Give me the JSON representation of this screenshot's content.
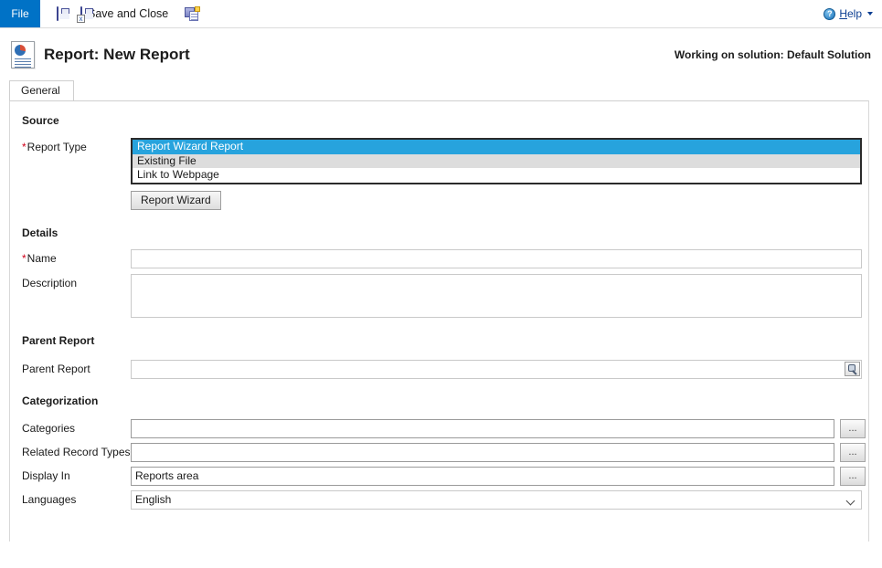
{
  "commandbar": {
    "file_tab": "File",
    "save_label": "",
    "save_close_label": "Save and Close",
    "save_new_label": "",
    "help_label": "Help",
    "help_label_underlined": "H",
    "help_label_rest": "elp"
  },
  "title": {
    "page_title": "Report: New Report",
    "solution_note": "Working on solution: Default Solution"
  },
  "tabs": [
    {
      "label": "General"
    }
  ],
  "form": {
    "sections": {
      "source": {
        "heading": "Source",
        "report_type_label": "Report Type",
        "report_type_required": "*",
        "report_type_options": [
          "Report Wizard Report",
          "Existing File",
          "Link to Webpage"
        ],
        "report_type_selected": "Report Wizard Report",
        "report_wizard_button": "Report Wizard"
      },
      "details": {
        "heading": "Details",
        "name_label": "Name",
        "name_required": "*",
        "name_value": "",
        "description_label": "Description",
        "description_value": ""
      },
      "parent": {
        "heading": "Parent Report",
        "parent_report_label": "Parent Report",
        "parent_report_value": ""
      },
      "categorization": {
        "heading": "Categorization",
        "categories_label": "Categories",
        "categories_value": "",
        "categories_ellipsis": "...",
        "related_record_types_label": "Related Record Types",
        "related_record_types_value": "",
        "related_record_types_ellipsis": "...",
        "display_in_label": "Display In",
        "display_in_value": "Reports area",
        "display_in_ellipsis": "...",
        "languages_label": "Languages",
        "languages_value": "English",
        "languages_options": [
          "English"
        ]
      }
    }
  },
  "colors": {
    "accent_blue": "#0072c6",
    "selection_blue": "#27a3dd",
    "required_red": "#d0021b",
    "link_blue": "#0a3d91"
  }
}
